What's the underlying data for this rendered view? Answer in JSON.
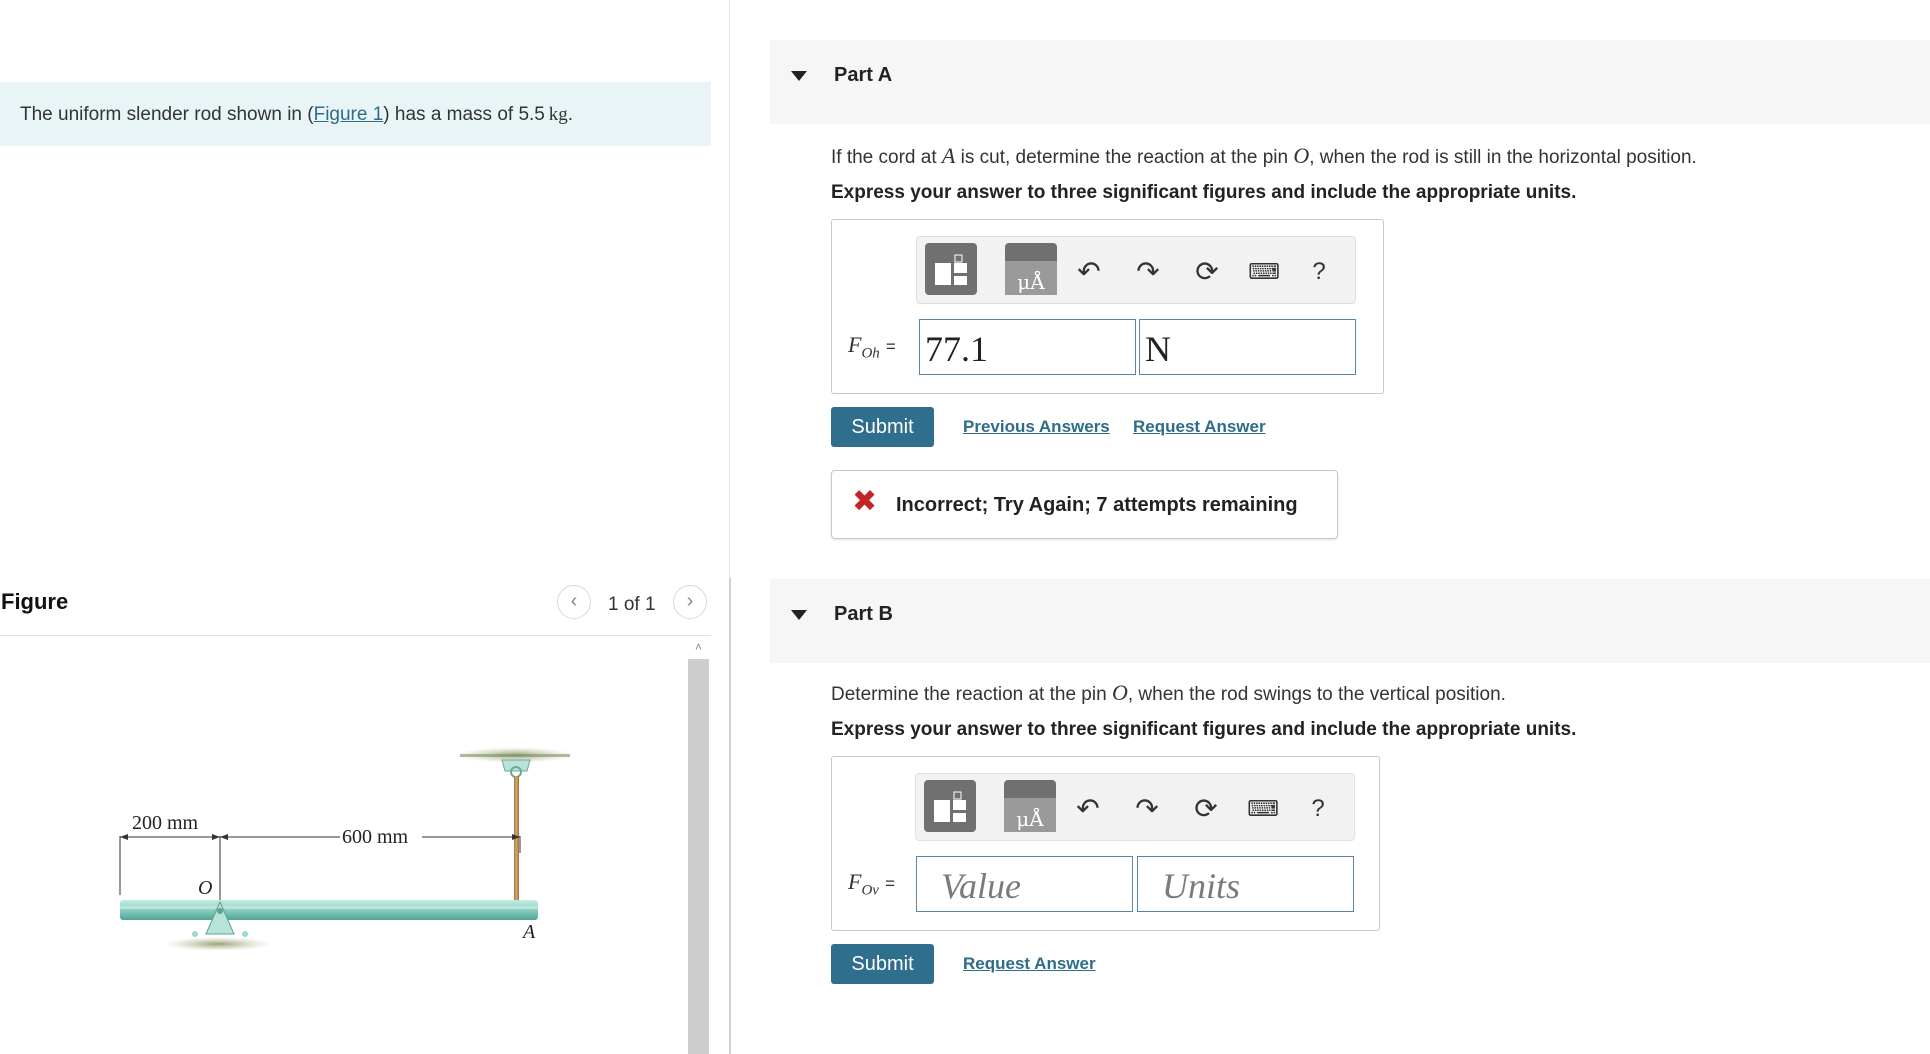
{
  "problem": {
    "intro_prefix": "The uniform slender rod shown in (",
    "intro_link": "Figure 1",
    "intro_suffix": ") has a mass of 5.5",
    "intro_unit": "kg",
    "intro_end": "."
  },
  "figure": {
    "title": "Figure",
    "pagination": "1 of 1",
    "prev_icon": "chevron-left-icon",
    "next_icon": "chevron-right-icon",
    "dim_left": "200 mm",
    "dim_right": "600 mm",
    "label_pin": "O",
    "label_end": "A"
  },
  "partA": {
    "label": "Part A",
    "question_1": "If the cord at",
    "var_a": "A",
    "question_2": "is cut, determine the reaction at the pin",
    "var_o": "O",
    "question_3": ", when the rod is still in the horizontal position.",
    "instruction": "Express your answer to three significant figures and include the appropriate units.",
    "eq_var": "F",
    "eq_sub": "Oh",
    "eq_sign": "=",
    "value": "77.1",
    "units": "N",
    "submit": "Submit",
    "previous_answers": "Previous Answers",
    "request_answer": "Request Answer",
    "feedback": "Incorrect; Try Again; 7 attempts remaining"
  },
  "partB": {
    "label": "Part B",
    "question_1": "Determine the reaction at the pin",
    "var_o": "O",
    "question_2": ", when the rod swings to the vertical position.",
    "instruction": "Express your answer to three significant figures and include the appropriate units.",
    "eq_var": "F",
    "eq_sub": "Ov",
    "eq_sign": "=",
    "value_placeholder": "Value",
    "units_placeholder": "Units",
    "submit": "Submit",
    "request_answer": "Request Answer"
  },
  "toolbar": {
    "templates_icon": "templates-icon",
    "units_icon": "units-icon",
    "units_glyph": "μÅ",
    "undo_icon": "undo-icon",
    "redo_icon": "redo-icon",
    "reset_icon": "reset-icon",
    "keyboard_icon": "keyboard-icon",
    "help_glyph": "?"
  },
  "colors": {
    "accent": "#2f6e8d",
    "link": "#2e6d8a",
    "intro_bg": "#e8f4f6",
    "error": "#c52424",
    "rod": "#8fd3c4"
  }
}
